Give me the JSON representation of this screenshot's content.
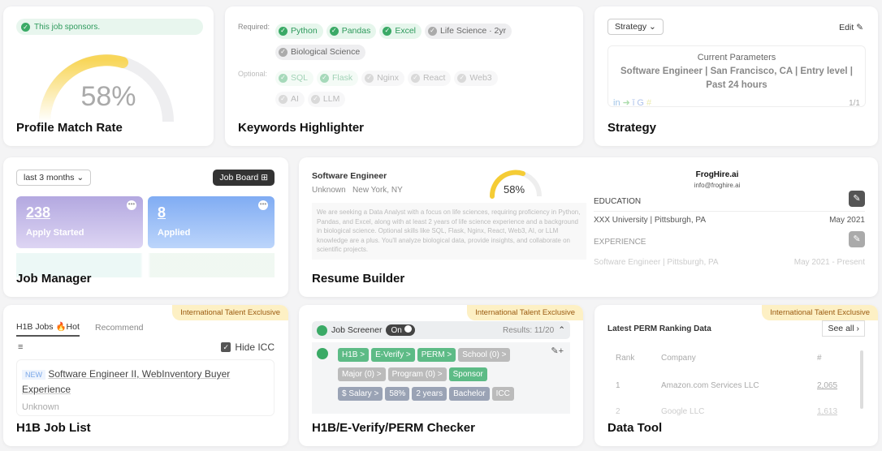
{
  "profile": {
    "sponsor_text": "This job sponsors.",
    "match_rate": "58%",
    "match_value": 58,
    "title": "Profile Match Rate"
  },
  "keywords": {
    "required_label": "Required:",
    "optional_label": "Optional:",
    "required": [
      {
        "label": "Python",
        "matched": true
      },
      {
        "label": "Pandas",
        "matched": true
      },
      {
        "label": "Excel",
        "matched": true
      },
      {
        "label": "Life Science · 2yr",
        "matched": false
      },
      {
        "label": "Biological Science",
        "matched": false
      }
    ],
    "optional": [
      {
        "label": "SQL",
        "matched": true
      },
      {
        "label": "Flask",
        "matched": true
      },
      {
        "label": "Nginx",
        "matched": false
      },
      {
        "label": "React",
        "matched": false
      },
      {
        "label": "Web3",
        "matched": false
      },
      {
        "label": "AI",
        "matched": false
      },
      {
        "label": "LLM",
        "matched": false
      }
    ],
    "title": "Keywords Highlighter"
  },
  "strategy": {
    "select": "Strategy",
    "edit": "Edit",
    "params_label": "Current Parameters",
    "params": "Software Engineer | San Francisco, CA | Entry level | Past 24 hours",
    "page": "1/1",
    "title": "Strategy"
  },
  "job_manager": {
    "range": "last 3 months",
    "job_board": "Job Board",
    "stats": [
      {
        "value": "238",
        "label": "Apply Started"
      },
      {
        "value": "8",
        "label": "Applied"
      }
    ],
    "title": "Job Manager"
  },
  "resume": {
    "job_title": "Software Engineer",
    "company": "Unknown",
    "location": "New York, NY",
    "match": "58%",
    "description": "We are seeking a Data Analyst with a focus on life sciences, requiring proficiency in Python, Pandas, and Excel, along with at least 2 years of life science experience and a background in biological science. Optional skills like SQL, Flask, Nginx, React, Web3, AI, or LLM knowledge are a plus. You'll analyze biological data, provide insights, and collaborate on scientific projects.",
    "name": "FrogHire.ai",
    "email": "info@froghire.ai",
    "education_label": "EDUCATION",
    "education": "XXX University | Pittsburgh, PA",
    "education_date": "May 2021",
    "experience_label": "EXPERIENCE",
    "experience": "Software Engineer | Pittsburgh, PA",
    "experience_date": "May 2021 - Present",
    "title": "Resume Builder"
  },
  "h1b": {
    "badge": "International Talent Exclusive",
    "tab1": "H1B Jobs",
    "hot": "🔥Hot",
    "tab2": "Recommend",
    "hide_icc": "Hide ICC",
    "new": "NEW",
    "job": "Software Engineer II, WebInventory Buyer Experience",
    "company": "Unknown",
    "title": "H1B Job List"
  },
  "checker": {
    "badge": "International Talent Exclusive",
    "screener": "Job Screener",
    "toggle": "On",
    "results": "Results: 11/20",
    "tags": [
      "H1B >",
      "E-Verify >",
      "PERM >",
      "School (0) >",
      "Major (0) >",
      "Program (0) >",
      "Sponsor",
      "$ Salary >",
      "58%",
      "2 years",
      "Bachelor",
      "ICC"
    ],
    "title": "H1B/E-Verify/PERM Checker"
  },
  "data_tool": {
    "badge": "International Talent Exclusive",
    "heading": "Latest PERM Ranking Data",
    "see_all": "See all",
    "cols": [
      "Rank",
      "Company",
      "#"
    ],
    "rows": [
      [
        "1",
        "Amazon.com Services LLC",
        "2,065"
      ],
      [
        "2",
        "Google LLC",
        "1,613"
      ]
    ],
    "title": "Data Tool"
  }
}
